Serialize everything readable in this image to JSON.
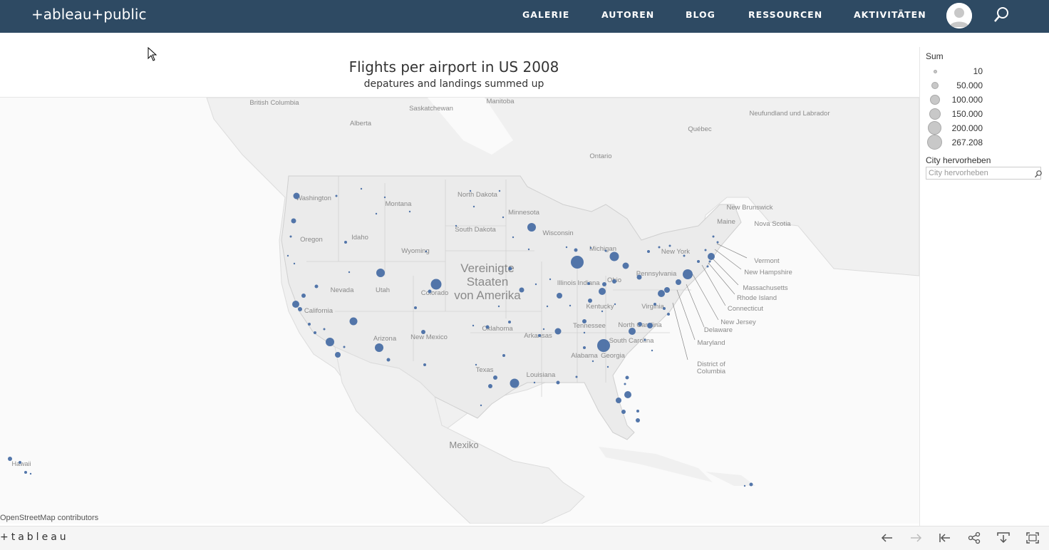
{
  "nav": {
    "logo": "+ableau+public",
    "links": [
      "GALERIE",
      "AUTOREN",
      "BLOG",
      "RESSOURCEN",
      "AKTIVITÄTEN"
    ]
  },
  "viz": {
    "title": "Flights per airport in US 2008",
    "subtitle": "depatures and landings summed up"
  },
  "legend": {
    "title": "Sum",
    "values": [
      "10",
      "50.000",
      "100.000",
      "150.000",
      "200.000",
      "267.208"
    ],
    "highlight_title": "City hervorheben",
    "highlight_placeholder": "City hervorheben"
  },
  "map": {
    "country_label": [
      "Vereinigte",
      "Staaten",
      "von Amerika"
    ],
    "mexico_label": "Mexiko",
    "hawaii_label": "Hawaii",
    "region_labels": [
      "British Columbia",
      "Alberta",
      "Saskatchewan",
      "Manitoba",
      "Ontario",
      "Québec",
      "Neufundland und Labrador",
      "New Brunswick",
      "Nova Scotia",
      "Washington",
      "Montana",
      "North Dakota",
      "South Dakota",
      "Minnesota",
      "Wisconsin",
      "Michigan",
      "Oregon",
      "Idaho",
      "Wyoming",
      "Nevada",
      "Utah",
      "Colorado",
      "California",
      "Arizona",
      "New Mexico",
      "Texas",
      "Oklahoma",
      "Arkansas",
      "Louisiana",
      "Illinois",
      "Indiana",
      "Ohio",
      "Kentucky",
      "Tennessee",
      "Alabama",
      "Georgia",
      "South Carolina",
      "North Carolina",
      "Virginia",
      "Pennsylvania",
      "New York",
      "Maine"
    ],
    "callouts": [
      "Vermont",
      "New Hampshire",
      "Massachusetts",
      "Rhode Island",
      "Connecticut",
      "New Jersey",
      "Delaware",
      "Maryland",
      "District of Columbia"
    ],
    "attribution": "OpenStreetMap contributors",
    "marker_color": "#4a6fa5"
  },
  "toolbar": {
    "logo": "+tableau"
  }
}
